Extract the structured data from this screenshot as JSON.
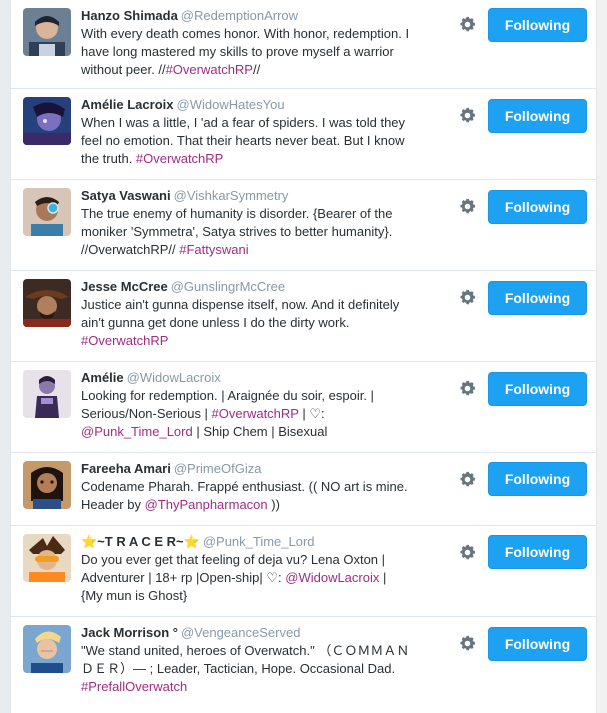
{
  "colors": {
    "accent": "#1da1f2",
    "hashtag": "#9e2d84",
    "handle": "#8899a6",
    "text": "#292f33"
  },
  "users": [
    {
      "display_name": "Hanzo Shimada",
      "handle": "@RedemptionArrow",
      "bio": [
        "With every death comes honor. With honor, redemption. I have long mastered my skills to prove myself a warrior without peer. //",
        "#OverwatchRP",
        "//"
      ],
      "button": "Following",
      "avatar": "hanzo"
    },
    {
      "display_name": "Amélie Lacroix",
      "handle": "@WidowHatesYou",
      "bio": [
        "When I was a little, I 'ad a fear of spiders. I was told they feel no emotion. That their hearts never beat. But I know the truth. ",
        "#OverwatchRP",
        ""
      ],
      "button": "Following",
      "avatar": "widow"
    },
    {
      "display_name": "Satya Vaswani",
      "handle": "@VishkarSymmetry",
      "bio": [
        "The true enemy of humanity is disorder. {Bearer of the moniker 'Symmetra', Satya strives to better humanity}. //OverwatchRP// ",
        "#Fattyswani",
        ""
      ],
      "button": "Following",
      "avatar": "symmetra"
    },
    {
      "display_name": "Jesse McCree",
      "handle": "@GunslingrMcCree",
      "bio": [
        "Justice ain't gunna dispense itself, now. And it definitely ain't gunna get done unless I do the dirty work. ",
        "#OverwatchRP",
        ""
      ],
      "button": "Following",
      "avatar": "mccree"
    },
    {
      "display_name": "Amélie",
      "handle": "@WidowLacroix",
      "bio": [
        "Looking for redemption. | Araignée du soir, espoir. | Serious/Non-Serious | ",
        "#OverwatchRP",
        " | ♡: ",
        "@Punk_Time_Lord",
        " | Ship Chem | Bisexual"
      ],
      "button": "Following",
      "avatar": "amelie"
    },
    {
      "display_name": "Fareeha Amari",
      "handle": "@PrimeOfGiza",
      "bio": [
        "Codename Pharah. Frappé enthusiast. (( NO art is mine. Header by ",
        "@ThyPanpharmacon",
        " ))"
      ],
      "button": "Following",
      "avatar": "pharah"
    },
    {
      "display_name": "⭐~T R A C E R~⭐",
      "handle": "@Punk_Time_Lord",
      "bio": [
        "Do you ever get that feeling of deja vu? Lena Oxton | Adventurer | 18+ rp |Open-ship| ♡: ",
        "@WidowLacroix",
        " | {My mun is Ghost}"
      ],
      "button": "Following",
      "avatar": "tracer"
    },
    {
      "display_name": "Jack Morrison °",
      "handle": "@VengeanceServed",
      "bio": [
        "\"We stand united, heroes of Overwatch.\" （ＣＯＭＭＡＮＤＥＲ）— ; Leader, Tactician, Hope. Occasional Dad. ",
        "#PrefallOverwatch",
        ""
      ],
      "button": "Following",
      "avatar": "morrison"
    }
  ]
}
